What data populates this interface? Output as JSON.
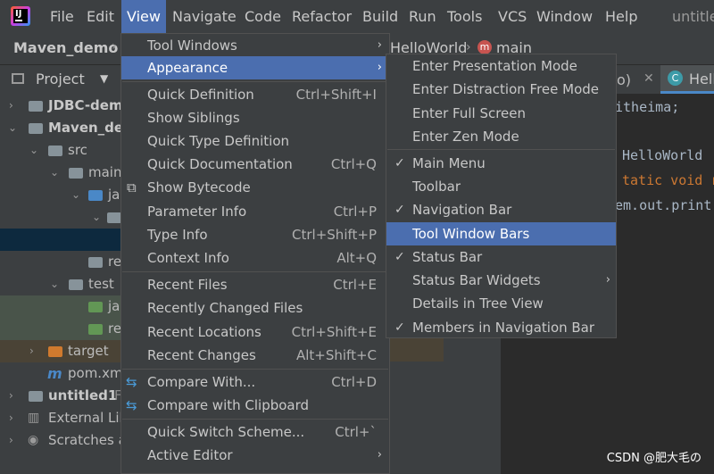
{
  "menubar": {
    "items": [
      "File",
      "Edit",
      "View",
      "Navigate",
      "Code",
      "Refactor",
      "Build",
      "Run",
      "Tools",
      "VCS",
      "Window",
      "Help"
    ],
    "window_title": "untitle"
  },
  "navbar": {
    "project": "Maven_demo",
    "breadcrumb_file": "HelloWorld",
    "breadcrumb_method": "main"
  },
  "tool_window": {
    "title": "Project"
  },
  "tree": [
    {
      "label": "JDBC-dem",
      "bold": true
    },
    {
      "label": "Maven_dem",
      "bold": true
    },
    {
      "label": "src"
    },
    {
      "label": "main"
    },
    {
      "label": "ja"
    },
    {
      "label": ""
    },
    {
      "label": ""
    },
    {
      "label": "re"
    },
    {
      "label": "test"
    },
    {
      "label": "ja"
    },
    {
      "label": "re"
    },
    {
      "label": "target"
    },
    {
      "label": "pom.xm"
    },
    {
      "label": "untitled1",
      "bold": true,
      "extra": "F"
    },
    {
      "label": "External Lib"
    },
    {
      "label": "Scratches a"
    }
  ],
  "editor": {
    "tab_partial": "o)",
    "tab_label": "Hell",
    "code": [
      "itheima;",
      "HelloWorld",
      "tatic void r",
      "em.out.print"
    ]
  },
  "view_menu": {
    "items": [
      {
        "label": "Tool Windows",
        "shortcut": "",
        "submenu": true
      },
      {
        "label": "Appearance",
        "shortcut": "",
        "submenu": true,
        "selected": true
      },
      {
        "label": "Quick Definition",
        "shortcut": "Ctrl+Shift+I"
      },
      {
        "label": "Show Siblings",
        "shortcut": ""
      },
      {
        "label": "Quick Type Definition",
        "shortcut": ""
      },
      {
        "label": "Quick Documentation",
        "shortcut": "Ctrl+Q"
      },
      {
        "label": "Show Bytecode",
        "shortcut": ""
      },
      {
        "label": "Parameter Info",
        "shortcut": "Ctrl+P"
      },
      {
        "label": "Type Info",
        "shortcut": "Ctrl+Shift+P"
      },
      {
        "label": "Context Info",
        "shortcut": "Alt+Q"
      },
      {
        "label": "Recent Files",
        "shortcut": "Ctrl+E"
      },
      {
        "label": "Recently Changed Files",
        "shortcut": ""
      },
      {
        "label": "Recent Locations",
        "shortcut": "Ctrl+Shift+E"
      },
      {
        "label": "Recent Changes",
        "shortcut": "Alt+Shift+C"
      },
      {
        "label": "Compare With...",
        "shortcut": "Ctrl+D"
      },
      {
        "label": "Compare with Clipboard",
        "shortcut": ""
      },
      {
        "label": "Quick Switch Scheme...",
        "shortcut": "Ctrl+`"
      },
      {
        "label": "Active Editor",
        "shortcut": "",
        "submenu": true
      }
    ]
  },
  "appearance_menu": {
    "items": [
      {
        "label": "Enter Presentation Mode",
        "checked": false
      },
      {
        "label": "Enter Distraction Free Mode",
        "checked": false
      },
      {
        "label": "Enter Full Screen",
        "checked": false
      },
      {
        "label": "Enter Zen Mode",
        "checked": false
      },
      {
        "label": "Main Menu",
        "checked": true
      },
      {
        "label": "Toolbar",
        "checked": false
      },
      {
        "label": "Navigation Bar",
        "checked": true
      },
      {
        "label": "Tool Window Bars",
        "checked": false,
        "selected": true
      },
      {
        "label": "Status Bar",
        "checked": true
      },
      {
        "label": "Status Bar Widgets",
        "checked": false,
        "submenu": true
      },
      {
        "label": "Details in Tree View",
        "checked": false
      },
      {
        "label": "Members in Navigation Bar",
        "checked": true
      }
    ]
  },
  "watermark": "CSDN @肥大毛の",
  "colors": {
    "selection": "#4b6eaf",
    "menu_bg": "#3c3f41",
    "editor_bg": "#2b2b2b"
  },
  "glyphs": {
    "check": "✓",
    "arrow": "›",
    "chevron_right": "›",
    "chevron_down": "⌄"
  }
}
